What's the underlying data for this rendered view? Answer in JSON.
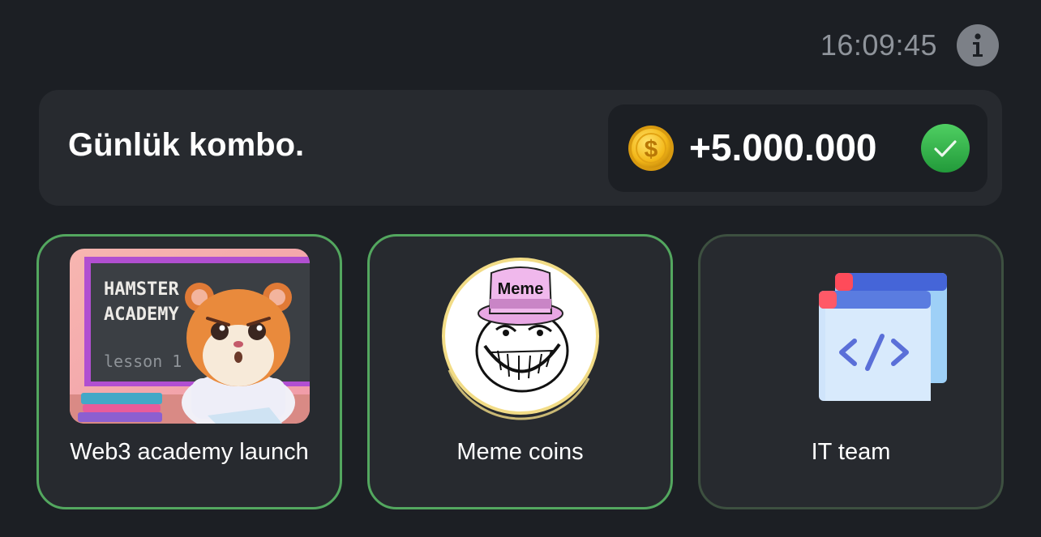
{
  "header": {
    "time": "16:09:45",
    "info_icon": "info-icon"
  },
  "combo": {
    "title": "Günlük kombo.",
    "reward": "+5.000.000",
    "coin_icon": "coin-icon",
    "status_icon": "check-icon",
    "colors": {
      "check": "#37b24d",
      "coin": "#f5c518"
    }
  },
  "cards": [
    {
      "label": "Web3 academy launch",
      "image": "hamster-academy-image",
      "sign_text": [
        "HAMSTER",
        "ACADEMY",
        "lesson 1"
      ]
    },
    {
      "label": "Meme coins",
      "image": "meme-troll-image",
      "hat_text": "Meme"
    },
    {
      "label": "IT team",
      "image": "code-window-icon"
    }
  ],
  "colors": {
    "background": "#1c1f24",
    "panel": "#272a2f",
    "card_border": "#53a75f"
  }
}
